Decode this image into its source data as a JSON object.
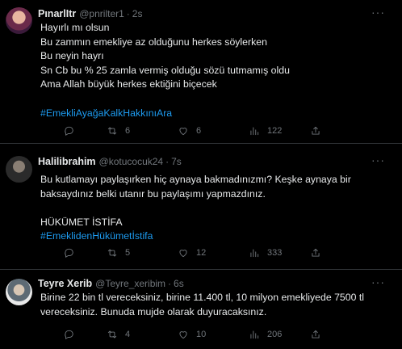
{
  "tweets": [
    {
      "name": "PınarlItr",
      "handle": "@pnrilter1",
      "time": "2s",
      "lines": [
        "Hayırlı mı olsun",
        "Bu zammın emekliye az olduğunu herkes söylerken",
        "Bu neyin hayrı",
        "Sn Cb bu % 25 zamla vermiş olduğu sözü tutmamış oldu",
        "Ama Allah büyük herkes ektiğini biçecek"
      ],
      "hashtags": [
        "#EmekliAyağaKalkHakkınıAra"
      ],
      "replies": "",
      "retweets": "6",
      "likes": "6",
      "views": "122"
    },
    {
      "name": "Halilibrahim",
      "handle": "@kotucocuk24",
      "time": "7s",
      "lines": [
        "Bu kutlamayı paylaşırken hiç aynaya bakmadınızmı? Keşke aynaya bir",
        "baksaydınız belki utanır bu paylaşımı yapmazdınız."
      ],
      "extra": "HÜKÜMET İSTİFA",
      "hashtags": [
        "#EmeklidenHükümetİstifa"
      ],
      "replies": "",
      "retweets": "5",
      "likes": "12",
      "views": "333"
    },
    {
      "name": "Teyre Xerib",
      "handle": "@Teyre_xeribim",
      "time": "6s",
      "lines": [
        "Birine 22 bin tl vereceksiniz, birine 11.400 tl, 10 milyon emekliyede  7500 tl",
        "vereceksiniz. Bunuda mujde olarak duyuracaksınız."
      ],
      "hashtags": [],
      "replies": "",
      "retweets": "4",
      "likes": "10",
      "views": "206"
    }
  ],
  "icons": {
    "more": "more-horizontal-icon",
    "reply": "reply-icon",
    "retweet": "retweet-icon",
    "like": "heart-icon",
    "views": "views-icon",
    "share": "share-icon"
  },
  "colors": {
    "background": "#000000",
    "text": "#e7e9ea",
    "muted": "#71767b",
    "link": "#1d9bf0",
    "divider": "#2f3336"
  }
}
